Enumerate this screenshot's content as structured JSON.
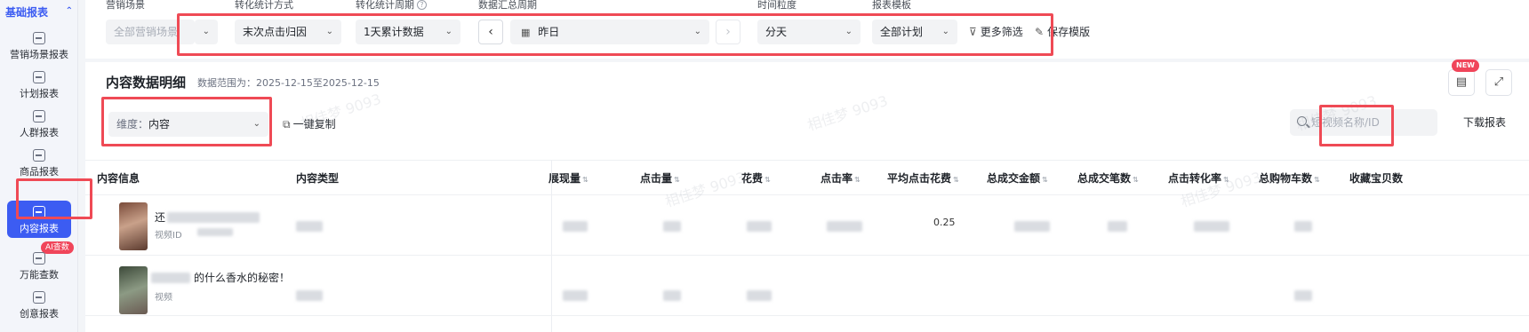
{
  "sidebar": {
    "section_title": "基础报表",
    "items": [
      {
        "label": "营销场景报表"
      },
      {
        "label": "计划报表"
      },
      {
        "label": "人群报表"
      },
      {
        "label": "商品报表"
      },
      {
        "label": "内容报表"
      },
      {
        "label": "万能查数"
      },
      {
        "label": "创意报表"
      }
    ],
    "ai_badge": "AI查数",
    "active_index": 4
  },
  "filters": {
    "scene": {
      "label": "营销场景",
      "placeholder": "全部营销场景"
    },
    "conversion_method": {
      "label": "转化统计方式",
      "value": "末次点击归因"
    },
    "conversion_period": {
      "label": "转化统计周期",
      "value": "1天累计数据"
    },
    "data_period": {
      "label": "数据汇总周期",
      "value": "昨日"
    },
    "time_granularity": {
      "label": "时间粒度",
      "value": "分天"
    },
    "report_template": {
      "label": "报表模板",
      "value": "全部计划"
    },
    "more_filters": "更多筛选",
    "save_template": "保存模版"
  },
  "content": {
    "title": "内容数据明细",
    "range_label": "数据范围为：2025-12-15至2025-12-15",
    "new_badge": "NEW",
    "dimension": {
      "label": "维度：",
      "value": "内容"
    },
    "copy_label": "一键复制",
    "search_placeholder": "短视频名称/ID",
    "download_label": "下载报表"
  },
  "table": {
    "columns": [
      "内容信息",
      "内容类型",
      "展现量",
      "点击量",
      "花费",
      "点击率",
      "平均点击花费",
      "总成交金额",
      "总成交笔数",
      "点击转化率",
      "总购物车数",
      "收藏宝贝数"
    ],
    "rows": [
      {
        "title": "还",
        "sub": "视频ID",
        "avg_cpc": "0.25"
      },
      {
        "title": "的什么香水的秘密！",
        "sub": "视频"
      }
    ]
  },
  "watermark": "相佳梦 9093",
  "colors": {
    "accent": "#3c5cf2",
    "highlight": "#ef4a55",
    "badge": "#f0455a"
  }
}
